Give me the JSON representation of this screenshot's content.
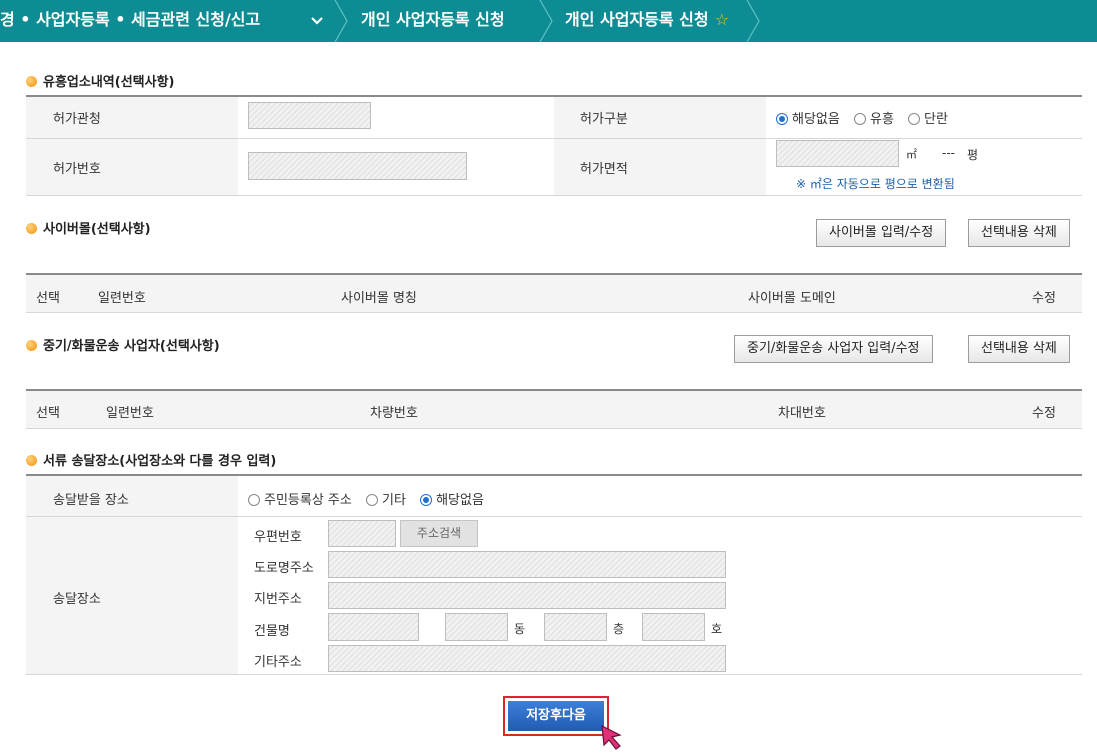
{
  "breadcrumb": {
    "item1": "경 • 사업자등록 • 세금관련 신청/신고",
    "item2": "개인 사업자등록 신청",
    "item3": "개인 사업자등록 신청"
  },
  "entertainment": {
    "title": "유흥업소내역(선택사항)",
    "permit_office_label": "허가관청",
    "permit_type_label": "허가구분",
    "permit_type_options": [
      "해당없음",
      "유흥",
      "단란"
    ],
    "permit_type_selected": "해당없음",
    "permit_number_label": "허가번호",
    "permit_area_label": "허가면적",
    "area_unit": "㎡",
    "pyeong_value": "---",
    "pyeong_unit": "평",
    "area_note": "※ ㎡은 자동으로 평으로 변환됨"
  },
  "cybermall": {
    "title": "사이버몰(선택사항)",
    "edit_button": "사이버몰 입력/수정",
    "delete_button": "선택내용 삭제",
    "columns": [
      "선택",
      "일련번호",
      "사이버몰 명칭",
      "사이버몰 도메인",
      "수정"
    ]
  },
  "freight": {
    "title": "중기/화물운송 사업자(선택사항)",
    "edit_button": "중기/화물운송 사업자 입력/수정",
    "delete_button": "선택내용 삭제",
    "columns": [
      "선택",
      "일련번호",
      "차량번호",
      "차대번호",
      "수정"
    ]
  },
  "delivery": {
    "title": "서류 송달장소(사업장소와 다를 경우 입력)",
    "place_label": "송달받을 장소",
    "place_options": [
      "주민등록상 주소",
      "기타",
      "해당없음"
    ],
    "place_selected": "해당없음",
    "address_label": "송달장소",
    "zip_label": "우편번호",
    "search_button": "주소검색",
    "road_label": "도로명주소",
    "lot_label": "지번주소",
    "building_label": "건물명",
    "dong_unit": "동",
    "floor_unit": "층",
    "ho_unit": "호",
    "other_label": "기타주소"
  },
  "save_button": "저장후다음"
}
